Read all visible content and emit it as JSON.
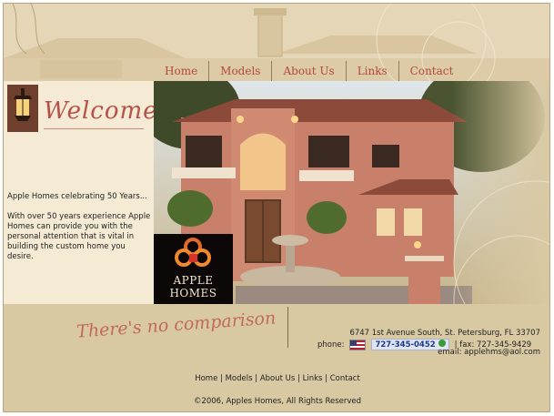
{
  "nav": {
    "items": [
      "Home",
      "Models",
      "About Us",
      "Links",
      "Contact"
    ]
  },
  "welcome": {
    "heading": "Welcome",
    "celebrate": "Apple Homes celebrating 50 Years...",
    "intro": "With over 50 years experience Apple Homes can provide you with the personal attention that is vital in building the custom home you desire."
  },
  "logo": {
    "name_line1": "APPLE",
    "name_line2": "HOMES"
  },
  "tagline": "There's no comparison",
  "contact": {
    "address": "6747 1st Avenue South, St. Petersburg, FL 33707",
    "phone_label": "phone:",
    "phone": "727-345-0452",
    "fax": "| fax: 727-345-9429",
    "email": "email: applehms@aol.com"
  },
  "footer": {
    "links": [
      "Home",
      "Models",
      "About Us",
      "Links",
      "Contact"
    ],
    "copyright": "©2006, Apples Homes, All Rights Reserved"
  },
  "colors": {
    "accent": "#b4493a",
    "background": "#d9c9a3",
    "panel": "#f5ead4"
  }
}
